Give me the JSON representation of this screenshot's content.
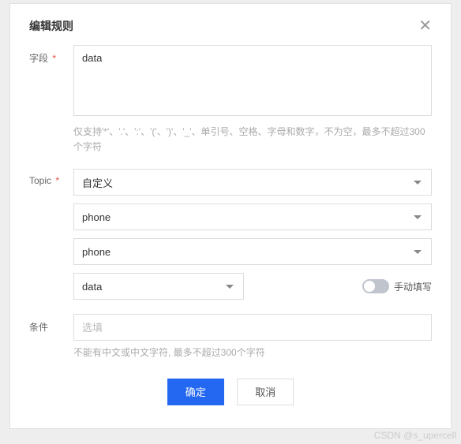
{
  "modal": {
    "title": "编辑规则"
  },
  "fields": {
    "field_label": "字段",
    "field_value": "data",
    "field_hint": "仅支持'*'、'.'、':'、'('、')'、'_'、单引号、空格、字母和数字，不为空，最多不超过300个字符",
    "topic_label": "Topic",
    "topic_select1": "自定义",
    "topic_select2": "phone",
    "topic_select3": "phone",
    "topic_select4": "data",
    "toggle_label": "手动填写",
    "condition_label": "条件",
    "condition_placeholder": "选填",
    "condition_hint": "不能有中文或中文字符, 最多不超过300个字符"
  },
  "buttons": {
    "ok": "确定",
    "cancel": "取消"
  },
  "watermark": "CSDN @s_upercell"
}
